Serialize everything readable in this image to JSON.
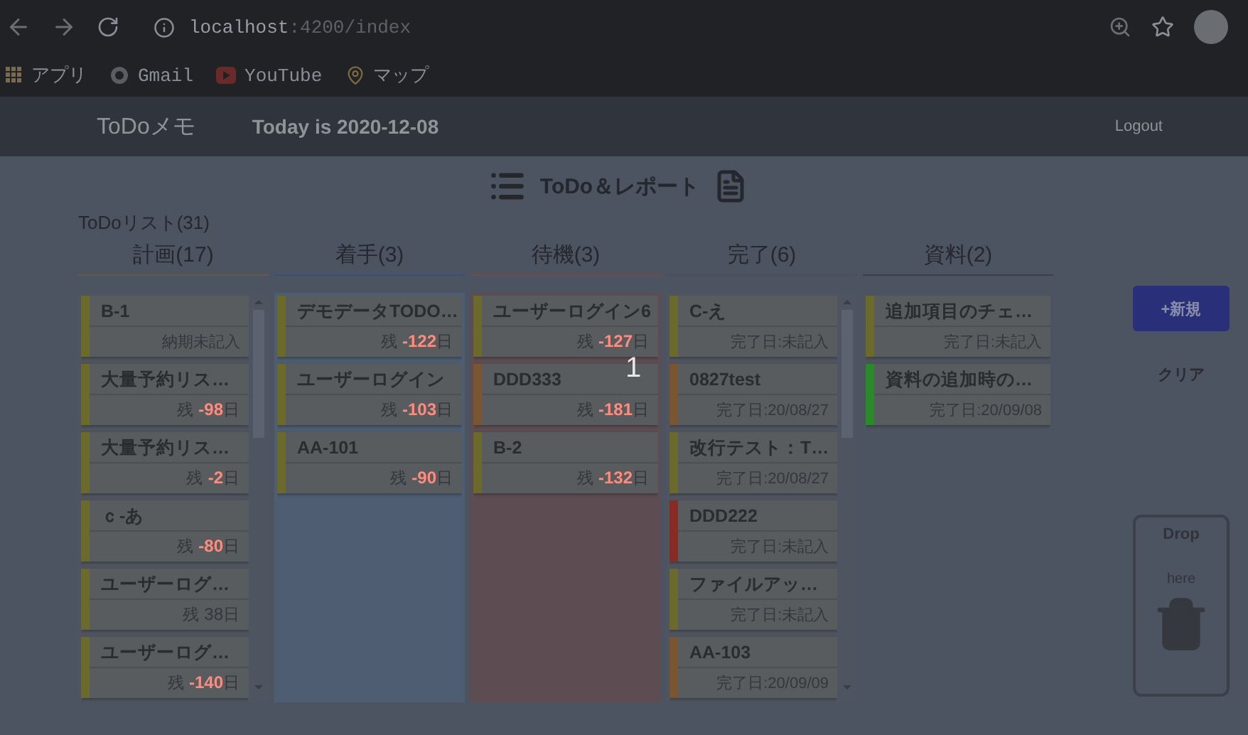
{
  "browser": {
    "url_host": "localhost",
    "url_path": ":4200/index",
    "bookmarks": [
      {
        "kind": "apps",
        "label": "アプリ"
      },
      {
        "kind": "gmail",
        "label": "Gmail"
      },
      {
        "kind": "youtube",
        "label": "YouTube"
      },
      {
        "kind": "maps",
        "label": "マップ"
      }
    ]
  },
  "header": {
    "brand": "ToDoメモ",
    "today": "Today is 2020-12-08",
    "logout": "Logout"
  },
  "page_title": "ToDo＆レポート",
  "list_title": "ToDoリスト(31)",
  "columns": [
    {
      "title": "計画(17)",
      "color": "#6a5a3a",
      "lane": {
        "color": "#4f5560"
      },
      "scroll": true,
      "cards": [
        {
          "title": "B-1",
          "kind": "plain",
          "note": "納期未記入",
          "color": "#6b6a2a"
        },
        {
          "title": "大量予約リス…",
          "kind": "remaining",
          "prefix": "残",
          "value": "-98",
          "unit": "日",
          "overdue": true,
          "color": "#6b6a2a"
        },
        {
          "title": "大量予約リス…",
          "kind": "remaining",
          "prefix": "残",
          "value": "-2",
          "unit": "日",
          "overdue": true,
          "color": "#6b6a2a"
        },
        {
          "title": "ｃ-あ",
          "kind": "remaining",
          "prefix": "残",
          "value": "-80",
          "unit": "日",
          "overdue": true,
          "color": "#6b6a2a"
        },
        {
          "title": "ユーザーログ…",
          "kind": "remaining",
          "prefix": "残",
          "value": "38",
          "unit": "日",
          "overdue": false,
          "color": "#6b6a2a"
        },
        {
          "title": "ユーザーログ…",
          "kind": "remaining",
          "prefix": "残",
          "value": "-140",
          "unit": "日",
          "overdue": true,
          "color": "#6b6a2a"
        }
      ]
    },
    {
      "title": "着手(3)",
      "color": "#3a4a8a",
      "lane": {
        "color": "#4e5d72"
      },
      "scroll": false,
      "cards": [
        {
          "title": "デモデータTODO…",
          "kind": "remaining",
          "prefix": "残",
          "value": "-122",
          "unit": "日",
          "overdue": true,
          "color": "#6b6a2a"
        },
        {
          "title": "ユーザーログイン",
          "kind": "remaining",
          "prefix": "残",
          "value": "-103",
          "unit": "日",
          "overdue": true,
          "color": "#6b6a2a"
        },
        {
          "title": "AA-101",
          "kind": "remaining",
          "prefix": "残",
          "value": "-90",
          "unit": "日",
          "overdue": true,
          "color": "#6b6a2a"
        }
      ]
    },
    {
      "title": "待機(3)",
      "color": "#7a4a3a",
      "lane": {
        "color": "#5d4d52"
      },
      "scroll": false,
      "cards": [
        {
          "title": "ユーザーログイン6",
          "kind": "remaining",
          "prefix": "残",
          "value": "-127",
          "unit": "日",
          "overdue": true,
          "color": "#6b6a2a"
        },
        {
          "title": "DDD333",
          "kind": "remaining",
          "prefix": "残",
          "value": "-181",
          "unit": "日",
          "overdue": true,
          "color": "#7a5530"
        },
        {
          "title": "B-2",
          "kind": "remaining",
          "prefix": "残",
          "value": "-132",
          "unit": "日",
          "overdue": true,
          "color": "#6b6a2a"
        }
      ]
    },
    {
      "title": "完了(6)",
      "color": "#4a4f5a",
      "lane": {
        "color": "#4f5560"
      },
      "scroll": true,
      "cards": [
        {
          "title": "C-え",
          "kind": "plain",
          "note": "完了日:未記入",
          "color": "#6b6a2a"
        },
        {
          "title": "0827test",
          "kind": "plain",
          "note": "完了日:20/08/27",
          "color": "#7a5530"
        },
        {
          "title": "改行テスト：T…",
          "kind": "plain",
          "note": "完了日:20/08/27",
          "color": "#6b6a2a"
        },
        {
          "title": "DDD222",
          "kind": "plain",
          "note": "完了日:未記入",
          "color": "#8a2a25"
        },
        {
          "title": "ファイルアッ…",
          "kind": "plain",
          "note": "完了日:未記入",
          "color": "#6b6a2a"
        },
        {
          "title": "AA-103",
          "kind": "plain",
          "note": "完了日:20/09/09",
          "color": "#7a5530"
        }
      ]
    },
    {
      "title": "資料(2)",
      "color": "#3a3f4a",
      "scroll": false,
      "cards": [
        {
          "title": "追加項目のチェ…",
          "kind": "plain",
          "note": "完了日:未記入",
          "color": "#6b6a2a"
        },
        {
          "title": "資料の追加時の…",
          "kind": "plain",
          "note": "完了日:20/09/08",
          "color": "#2a8a2a"
        }
      ]
    }
  ],
  "actions": {
    "new": "+新規",
    "clear": "クリア"
  },
  "dropzone": {
    "line_1": "Drop",
    "line_2": "here"
  },
  "overlay_text": "1"
}
